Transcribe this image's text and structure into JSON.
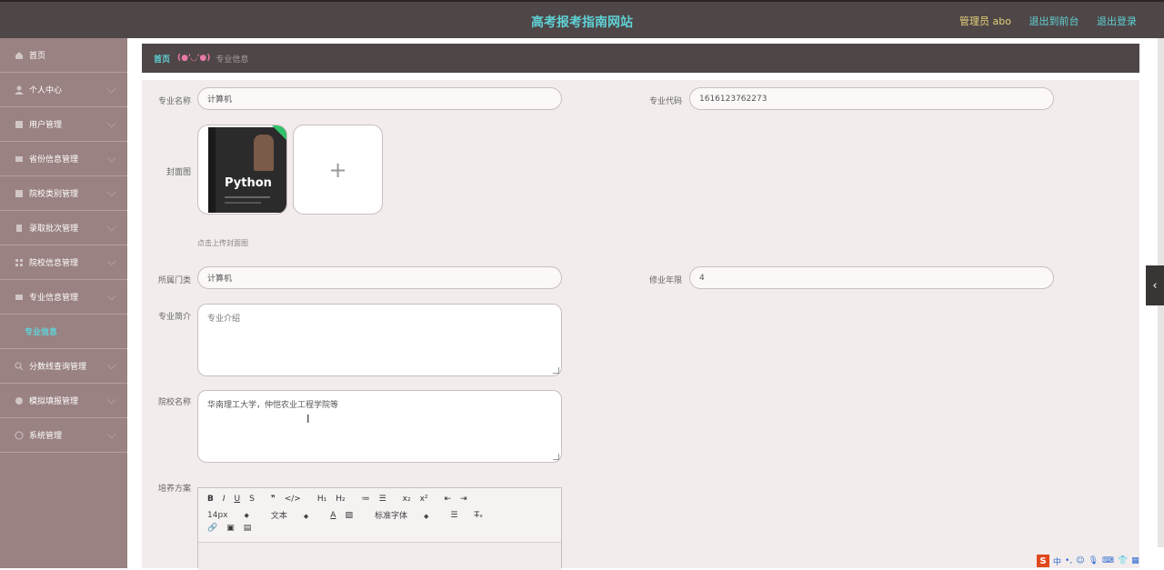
{
  "header": {
    "title": "高考报考指南网站",
    "admin_label": "管理员 abo",
    "link_front": "退出到前台",
    "link_logout": "退出登录"
  },
  "sidebar": {
    "items": [
      {
        "label": "首页",
        "icon": "home-icon"
      },
      {
        "label": "个人中心",
        "icon": "user-icon"
      },
      {
        "label": "用户管理",
        "icon": "users-icon"
      },
      {
        "label": "省份信息管理",
        "icon": "map-icon"
      },
      {
        "label": "院校类别管理",
        "icon": "category-icon"
      },
      {
        "label": "录取批次管理",
        "icon": "batch-icon"
      },
      {
        "label": "院校信息管理",
        "icon": "school-icon"
      },
      {
        "label": "专业信息管理",
        "icon": "major-icon"
      }
    ],
    "active_sub": "专业信息",
    "items_after": [
      {
        "label": "分数线查询管理",
        "icon": "search-icon"
      },
      {
        "label": "模拟填报管理",
        "icon": "form-icon"
      },
      {
        "label": "系统管理",
        "icon": "gear-icon"
      }
    ]
  },
  "breadcrumb": {
    "home": "首页",
    "separator": "(●'◡'●)",
    "current": "专业信息"
  },
  "form": {
    "major_name_label": "专业名称",
    "major_name_value": "计算机",
    "major_code_label": "专业代码",
    "major_code_value": "1616123762273",
    "cover_label": "封面图",
    "cover_book_title": "Python",
    "upload_plus": "+",
    "upload_hint": "点击上传封面图",
    "category_label": "所属门类",
    "category_value": "计算机",
    "years_label": "修业年限",
    "years_value": "4",
    "intro_label": "专业简介",
    "intro_placeholder": "专业介绍",
    "school_label": "院校名称",
    "school_value": "华南理工大学，仲恺农业工程学院等",
    "plan_label": "培养方案"
  },
  "editor": {
    "row1": [
      "B",
      "I",
      "U",
      "S",
      "❞",
      "</>",
      "H₁",
      "H₂",
      "≔",
      "☰",
      "x₂",
      "x²",
      "⇤",
      "⇥"
    ],
    "font_size": "14px",
    "text_style": "文本",
    "font_family": "标准字体",
    "row3": [
      "🔗",
      "▣",
      "▤"
    ]
  },
  "tray": {
    "ime": "中"
  }
}
